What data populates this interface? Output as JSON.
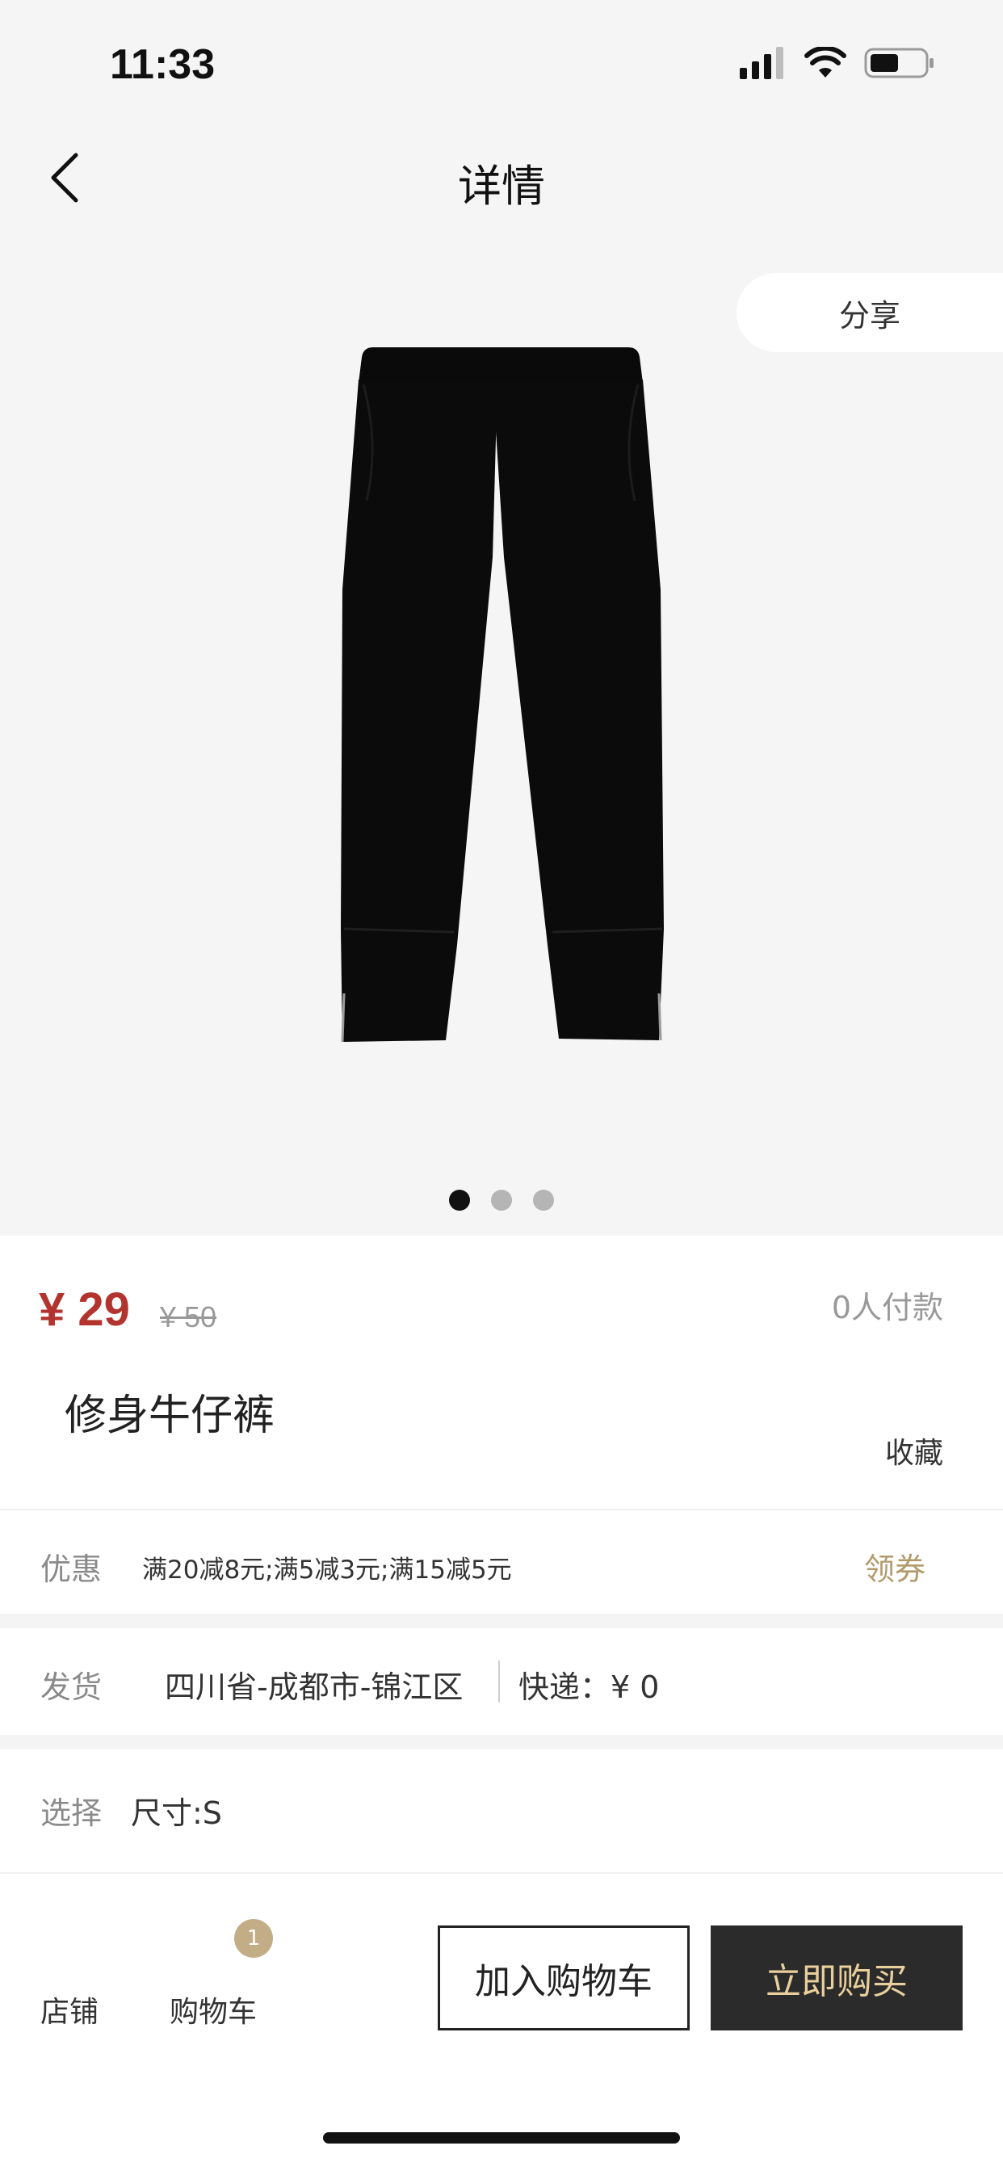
{
  "status_bar": {
    "time": "11:33"
  },
  "nav": {
    "title": "详情"
  },
  "gallery": {
    "share_label": "分享",
    "image_icon": "pants-photo",
    "page_count": 3,
    "active_index": 0
  },
  "product": {
    "price": "¥ 29",
    "original_price": "¥ 50",
    "paid_count": "0人付款",
    "name": "修身牛仔裤",
    "favorite_label": "收藏"
  },
  "promo": {
    "label": "优惠",
    "text": "满20减8元;满5减3元;满15减5元",
    "coupon_label": "领券"
  },
  "shipping": {
    "label": "发货",
    "origin": "四川省-成都市-锦江区",
    "fee": "快递：¥ 0"
  },
  "selection": {
    "label": "选择",
    "value": "尺寸:S"
  },
  "bottom_bar": {
    "store_label": "店铺",
    "cart_label": "购物车",
    "cart_count": "1",
    "add_to_cart_label": "加入购物车",
    "buy_now_label": "立即购买"
  },
  "colors": {
    "price": "#b3342e",
    "accent_gold": "#b39a6b",
    "badge": "#c2ad87",
    "buy_button_bg": "#2b2b2b",
    "buy_button_text": "#e8cf9c"
  }
}
